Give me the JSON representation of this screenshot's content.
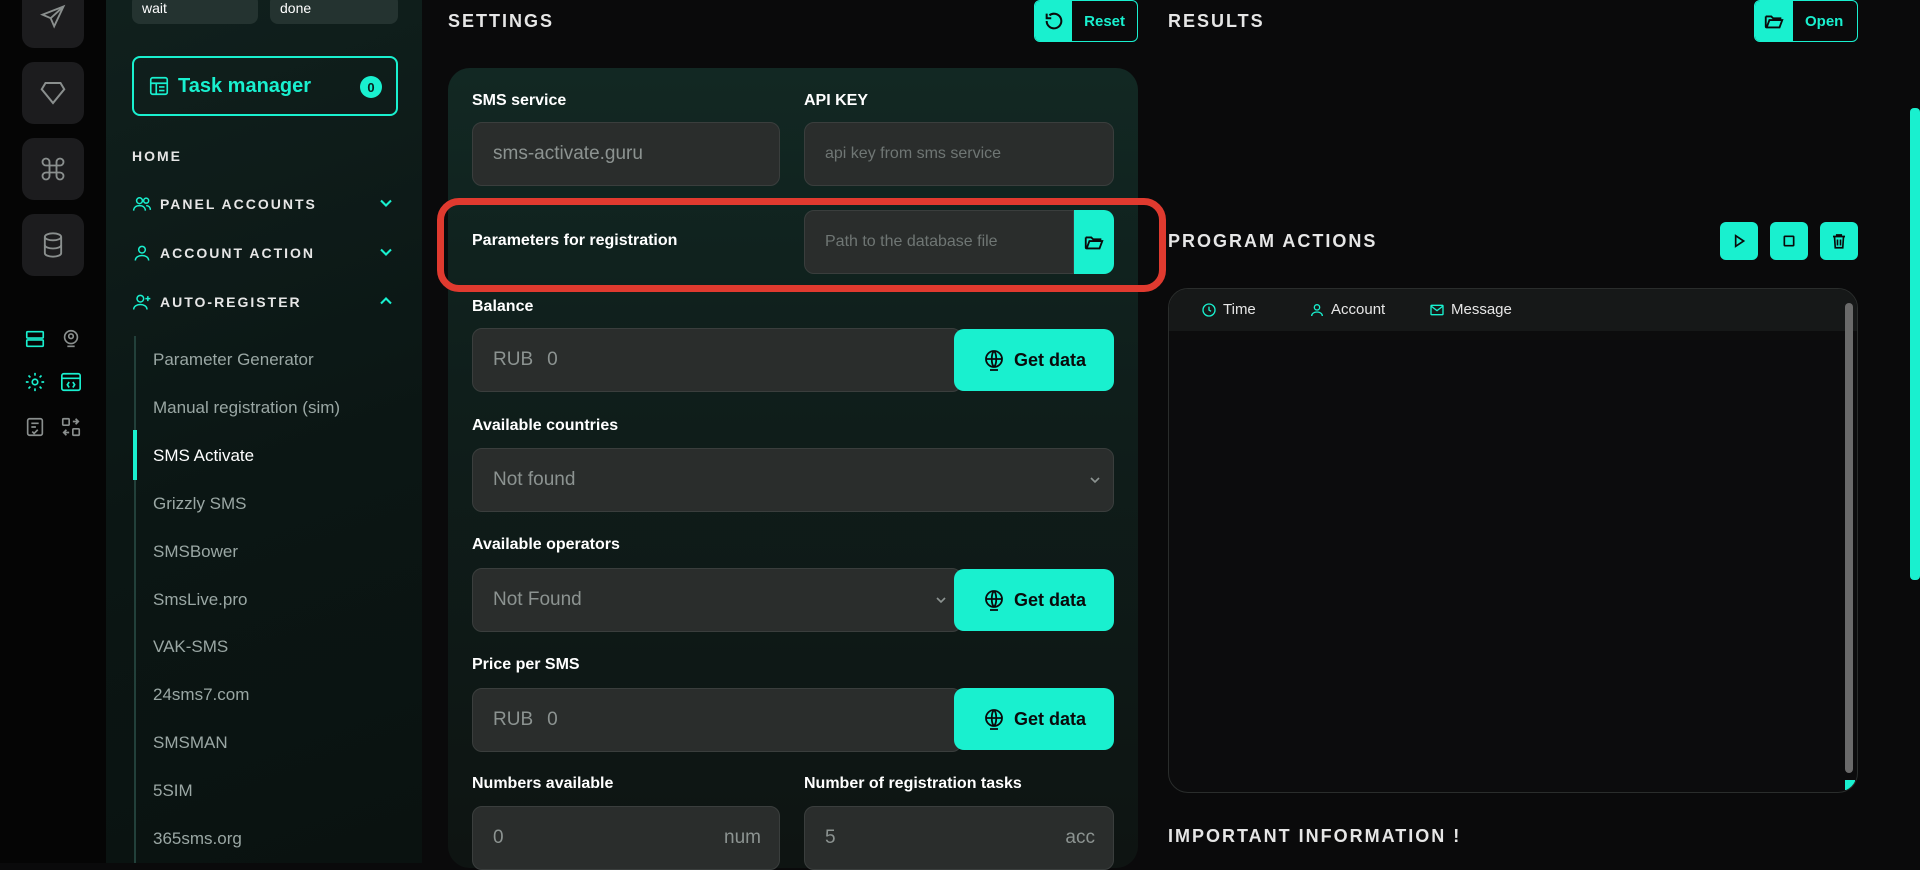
{
  "rail": {
    "icons": [
      "send-icon",
      "diamond-icon",
      "command-icon",
      "database-icon"
    ]
  },
  "sidebar": {
    "top_pills": [
      "wait",
      "done"
    ],
    "task_manager": {
      "label": "Task manager",
      "count": "0"
    },
    "home": "HOME",
    "sections": [
      {
        "label": "PANEL ACCOUNTS",
        "expanded": false
      },
      {
        "label": "ACCOUNT ACTION",
        "expanded": false
      },
      {
        "label": "AUTO-REGISTER",
        "expanded": true
      }
    ],
    "items": [
      "Parameter Generator",
      "Manual registration (sim)",
      "SMS Activate",
      "Grizzly SMS",
      "SMSBower",
      "SmsLive.pro",
      "VAK-SMS",
      "24sms7.com",
      "SMSMAN",
      "5SIM",
      "365sms.org"
    ],
    "active_item": "SMS Activate"
  },
  "settings": {
    "title": "SETTINGS",
    "reset_label": "Reset",
    "sms_service_label": "SMS service",
    "sms_service_value": "sms-activate.guru",
    "api_key_label": "API KEY",
    "api_key_placeholder": "api key from sms service",
    "params_label": "Parameters for registration",
    "params_placeholder": "Path to the database file",
    "balance_label": "Balance",
    "balance_currency": "RUB",
    "balance_value": "0",
    "get_data_label": "Get data",
    "countries_label": "Available countries",
    "countries_value": "Not found",
    "operators_label": "Available operators",
    "operators_value": "Not Found",
    "price_label": "Price per SMS",
    "price_currency": "RUB",
    "price_value": "0",
    "numbers_label": "Numbers available",
    "numbers_value": "0",
    "numbers_unit": "num",
    "tasks_label": "Number of registration tasks",
    "tasks_value": "5",
    "tasks_unit": "acc"
  },
  "results": {
    "title": "RESULTS",
    "open_label": "Open"
  },
  "actions": {
    "title": "PROGRAM ACTIONS",
    "columns": [
      "Time",
      "Account",
      "Message"
    ]
  },
  "important": "IMPORTANT INFORMATION !",
  "colors": {
    "accent": "#19f0cf",
    "highlight": "#e03a2f"
  }
}
